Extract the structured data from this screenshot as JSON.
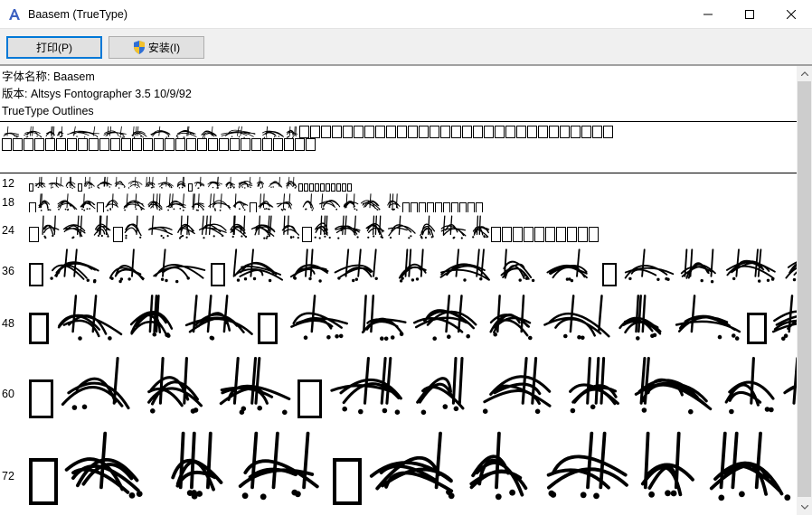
{
  "window": {
    "title": "Baasem (TrueType)",
    "minimize_glyph": "—",
    "maximize_glyph": "☐",
    "close_glyph": "✕"
  },
  "toolbar": {
    "print_label": "打印(P)",
    "install_label": "安装(I)"
  },
  "font_info": {
    "name_line": "字体名称: Baasem",
    "version_line": "版本: Altsys Fontographer 3.5  10/9/92",
    "type_line": "TrueType Outlines"
  },
  "samples": [
    {
      "size": "12"
    },
    {
      "size": "18"
    },
    {
      "size": "24"
    },
    {
      "size": "36"
    },
    {
      "size": "48"
    },
    {
      "size": "60"
    },
    {
      "size": "72"
    }
  ],
  "icons": {
    "app": "font-a-icon",
    "install": "uac-shield-icon",
    "minimize": "minimize-icon",
    "maximize": "maximize-icon",
    "close": "close-icon"
  },
  "colors": {
    "toolbar_bg": "#f0f0f0",
    "button_bg": "#e1e1e1",
    "focus_border": "#0078d7"
  }
}
